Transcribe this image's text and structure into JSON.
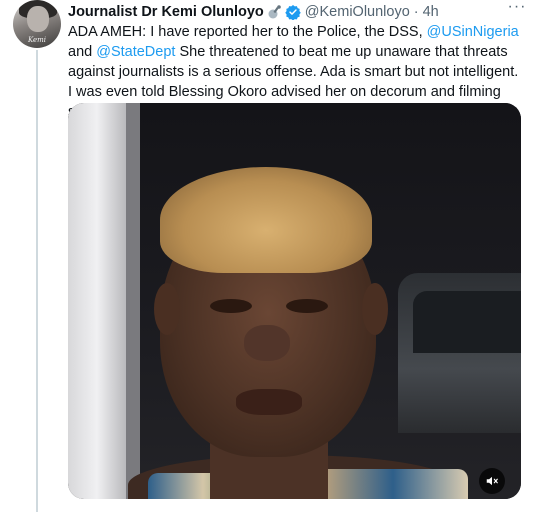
{
  "tweet": {
    "author_name": "Journalist Dr Kemi Olunloyo",
    "handle": "@KemiOlunloyo",
    "separator": "·",
    "time": "4h",
    "more_label": "···",
    "avatar_caption": "Kemi",
    "text_part1": "ADA AMEH: I have reported her to the Police, the DSS, ",
    "mention1": "@USinNigeria",
    "text_part2": " and ",
    "mention2": "@StateDept",
    "text_part3": " She threatened to beat me up unaware that threats against journalists is a serious offense. Ada is smart but not intelligent. I was even told Blessing Okoro advised her on decorum and filming such.",
    "media": {
      "type": "video",
      "mute_icon": "speaker-muted-icon"
    }
  },
  "colors": {
    "link": "#1d9bf0",
    "secondary_text": "#536471",
    "primary_text": "#0f1419",
    "verified": "#1d9bf0"
  }
}
